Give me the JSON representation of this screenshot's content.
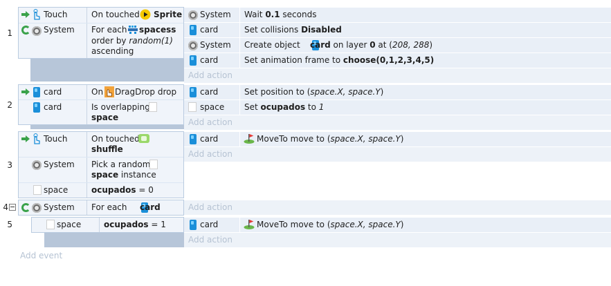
{
  "events": [
    {
      "number": "1",
      "conditions": [
        {
          "object": "Touch",
          "icon": "touch-icon",
          "text_pre": "On touched ",
          "text_bold": "Sprite",
          "text_post": "",
          "param_icon": "sprite-play-icon"
        },
        {
          "object": "System",
          "icon": "system-gear-icon",
          "line1_pre": "For each ",
          "line1_bold": "spacess",
          "line2_pre": "order by ",
          "line2_italic": "random(1)",
          "line3": "ascending",
          "param_icon": "spacess-sprite-icon"
        }
      ],
      "actions": [
        {
          "object": "System",
          "icon": "system-gear-icon",
          "text_pre": "Wait ",
          "text_bold": "0.1",
          "text_post": " seconds"
        },
        {
          "object": "card",
          "icon": "card-icon",
          "text_pre": "Set collisions ",
          "text_bold": "Disabled"
        },
        {
          "object": "System",
          "icon": "system-gear-icon",
          "text_pre": "Create object ",
          "text_bold": "card",
          "text_mid": " on layer ",
          "text_bold2": "0",
          "text_mid2": " at (",
          "text_italic": "208, 288",
          "text_post": ")"
        },
        {
          "object": "card",
          "icon": "card-icon",
          "text_pre": "Set animation frame to ",
          "text_bold": "choose(0,1,2,3,4,5)"
        }
      ],
      "add_action": "Add action"
    },
    {
      "number": "2",
      "conditions": [
        {
          "object": "card",
          "icon": "card-icon",
          "text_pre": "On ",
          "text_mid": " DragDrop drop",
          "param_icon": "dragdrop-hand-icon"
        },
        {
          "object": "card",
          "icon": "card-icon",
          "line1": "Is overlapping",
          "line2_bold": "space"
        }
      ],
      "actions": [
        {
          "object": "card",
          "icon": "card-icon",
          "text_pre": "Set position to (",
          "text_italic": "space.X, space.Y",
          "text_post": ")"
        },
        {
          "object": "space",
          "icon": "space-icon",
          "text_pre": "Set ",
          "text_bold": "ocupados",
          "text_mid": " to ",
          "text_italic": "1"
        }
      ],
      "add_action": "Add action"
    },
    {
      "number": "3",
      "conditions": [
        {
          "object": "Touch",
          "icon": "touch-icon",
          "line1": "On touched",
          "line2_bold": "shuffle",
          "param_icon": "shuffle-icon"
        },
        {
          "object": "System",
          "icon": "system-gear-icon",
          "line1": "Pick a random",
          "line2_bold": "space",
          "line2_post": " instance"
        },
        {
          "object": "space",
          "icon": "space-icon",
          "text_bold": "ocupados",
          "text_post": " = 0"
        }
      ],
      "actions": [
        {
          "object": "card",
          "icon": "card-icon",
          "text_pre": "MoveTo move to (",
          "text_italic": "space.X, space.Y",
          "text_post": ")",
          "behavior_icon": "moveto-flag-icon"
        }
      ],
      "add_action": "Add action"
    },
    {
      "number": "4",
      "collapse": "−",
      "conditions": [
        {
          "object": "System",
          "icon": "system-gear-icon",
          "text_pre": "For each ",
          "text_bold": "card"
        }
      ],
      "add_action": "Add action"
    },
    {
      "number": "5",
      "conditions": [
        {
          "object": "space",
          "icon": "space-icon",
          "text_bold": "ocupados",
          "text_post": " = 1"
        }
      ],
      "actions": [
        {
          "object": "card",
          "icon": "card-icon",
          "text_pre": "MoveTo move to (",
          "text_italic": "space.X, space.Y",
          "text_post": ")",
          "behavior_icon": "moveto-flag-icon"
        }
      ],
      "add_action": "Add action"
    }
  ],
  "add_event": "Add event",
  "colors": {
    "condition_bg": "#f0f4fa",
    "condition_border": "#b9cbe0",
    "event_filler": "#b7c6d9",
    "action_bg": "#e9eff7",
    "add_text": "#b6c3d3"
  }
}
